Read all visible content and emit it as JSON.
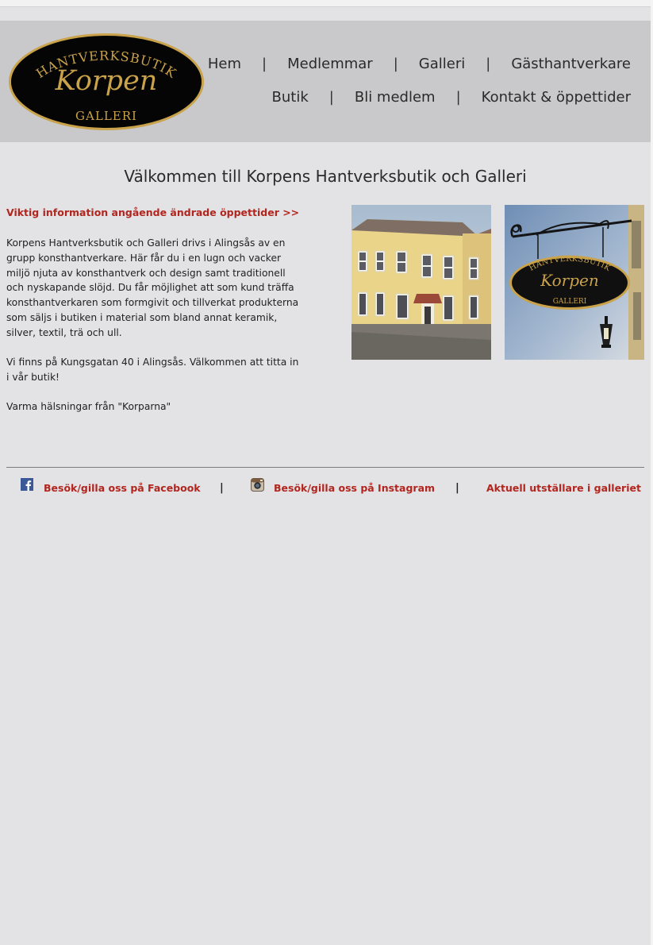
{
  "header": {
    "logo": {
      "top_text": "HANTVERKSBUTIK",
      "middle_text": "Korpen",
      "bottom_text": "GALLERI"
    },
    "nav": {
      "row1": [
        "Hem",
        "Medlemmar",
        "Galleri",
        "Gästhantverkare"
      ],
      "row2": [
        "Butik",
        "Bli medlem",
        "Kontakt & öppettider"
      ],
      "separator": "|"
    }
  },
  "main": {
    "welcome_title": "Välkommen till Korpens Hantverksbutik och Galleri",
    "important_link": "Viktig information angående ändrade öppettider >>",
    "paragraph1": "Korpens Hantverksbutik och Galleri drivs i Alingsås av en grupp konsthantverkare. Här får du i en lugn och vacker miljö njuta av konsthantverk och design samt traditionell och nyskapande slöjd. Du får möjlighet att som kund träffa konsthantverkaren som formgivit och tillverkat produkterna som säljs i butiken i material som bland annat keramik, silver, textil, trä och ull.",
    "paragraph2": "Vi finns på Kungsgatan 40 i Alingsås. Välkommen att titta in i vår butik!",
    "paragraph3": "Varma hälsningar från \"Korparna\"",
    "sign": {
      "top_text": "HANTVERKSBUTIK",
      "middle_text": "Korpen",
      "bottom_text": "GALLERI"
    }
  },
  "footer": {
    "facebook_link": "Besök/gilla oss på Facebook",
    "instagram_link": "Besök/gilla oss på Instagram",
    "exhibitor_link": "Aktuell utställare i galleriet",
    "separator": "|"
  },
  "colors": {
    "background": "#e3e2e4",
    "header_background": "#c9c8ca",
    "link_red": "#b1261f",
    "logo_gold": "#c9a24a"
  }
}
